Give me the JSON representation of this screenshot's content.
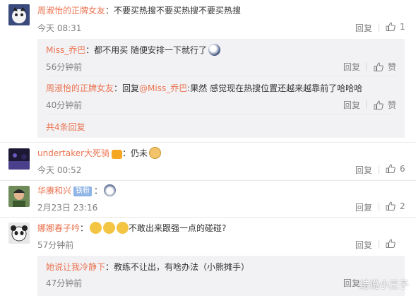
{
  "actions": {
    "reply": "回复",
    "like": "赞"
  },
  "comments": [
    {
      "user": "周淑怡的正牌女友",
      "text": "：不要买热搜不要买热搜不要买热搜",
      "time": "今天 08:31",
      "likes": "1",
      "replies": [
        {
          "user": "Miss_乔巴",
          "text": "：都不用买 随便安排一下就行了",
          "time": "56分钟前"
        },
        {
          "user": "周淑怡的正牌女友",
          "text_prefix": "：回复",
          "mention": "@Miss_乔巴",
          "text": ":果然 感觉现在热搜位置还越来越靠前了哈哈哈",
          "time": "40分钟前"
        }
      ],
      "more": "共4条回复"
    },
    {
      "user": "undertaker大死骑",
      "text": "：仍未",
      "time": "今天 00:52",
      "likes": "6"
    },
    {
      "user": "华赓和兴",
      "badge": "铁粉",
      "text": "：",
      "time": "2月23日 23:16",
      "likes": "2"
    },
    {
      "user": "娜娜春子吟",
      "text": "：不敢出来跟强一点的碰碰?",
      "time": "57分钟前",
      "replies": [
        {
          "user": "她说让我冷静下",
          "text": "：教练不让出，有啥办法（小熊摊手）",
          "time": "47分钟前"
        }
      ]
    }
  ],
  "watermark": "结说小王子",
  "colors": {
    "accent": "#eb7350",
    "reply_bg": "#f2f2f5",
    "muted": "#808080"
  }
}
